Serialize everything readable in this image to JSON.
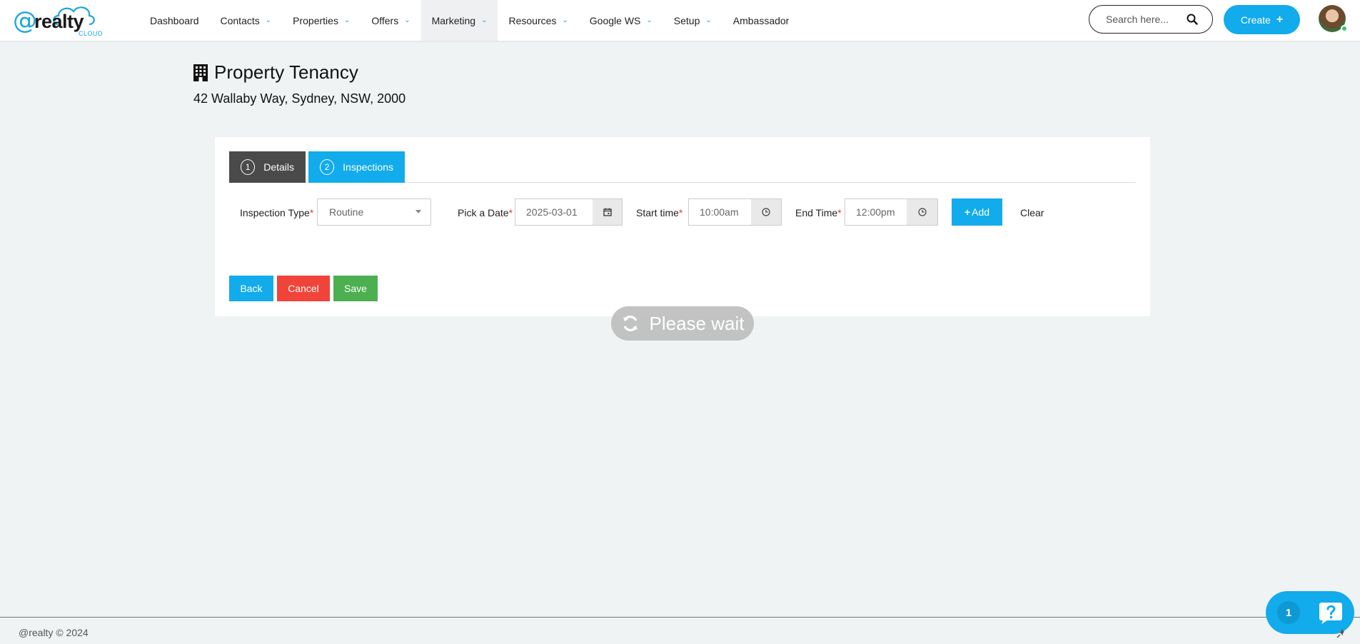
{
  "brand": {
    "at": "@",
    "word": "realty",
    "sub": "CLOUD"
  },
  "nav": [
    {
      "label": "Dashboard",
      "dropdown": false
    },
    {
      "label": "Contacts",
      "dropdown": true
    },
    {
      "label": "Properties",
      "dropdown": true
    },
    {
      "label": "Offers",
      "dropdown": true
    },
    {
      "label": "Marketing",
      "dropdown": true
    },
    {
      "label": "Resources",
      "dropdown": true
    },
    {
      "label": "Google WS",
      "dropdown": true
    },
    {
      "label": "Setup",
      "dropdown": true
    },
    {
      "label": "Ambassador",
      "dropdown": false
    }
  ],
  "search": {
    "placeholder": "Search here..."
  },
  "create": {
    "label": "Create",
    "icon": "+"
  },
  "page": {
    "title": "Property Tenancy",
    "address": "42 Wallaby Way, Sydney, NSW, 2000"
  },
  "tabs": [
    {
      "num": "1",
      "label": "Details"
    },
    {
      "num": "2",
      "label": "Inspections"
    }
  ],
  "form": {
    "inspection_type_label": "Inspection Type",
    "inspection_type_value": "Routine",
    "date_label": "Pick a Date",
    "date_value": "2025-03-01",
    "start_label": "Start time",
    "start_value": "10:00am",
    "end_label": "End Time",
    "end_value": "12:00pm",
    "required_mark": "*",
    "add_label": "Add",
    "clear_label": "Clear"
  },
  "actions": {
    "back": "Back",
    "cancel": "Cancel",
    "save": "Save"
  },
  "overlay": {
    "wait_text": "Please wait"
  },
  "footer": {
    "copyright": "@realty © 2024"
  },
  "chat": {
    "count": "1"
  },
  "colors": {
    "accent": "#12abeb",
    "danger": "#f0443a",
    "success": "#4caf50",
    "dark_tab": "#4a4a4a"
  }
}
